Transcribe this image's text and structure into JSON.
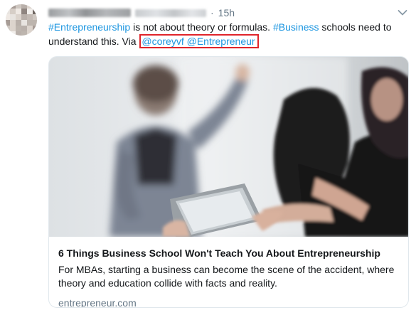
{
  "tweet": {
    "timestamp": "15h",
    "separator": "·",
    "text": {
      "hashtag_1": "#Entrepreneurship",
      "segment_1": " is not about theory or formulas. ",
      "hashtag_2": "#Business",
      "segment_2": " schools need to understand this. Via ",
      "mention_1": "@coreyvf",
      "mention_2": "@Entrepreneur"
    },
    "more_icon": "chevron-down-icon"
  },
  "card": {
    "title": "6 Things Business School Won't Teach You About Entrepreneurship",
    "description": "For MBAs, starting a business can become the scene of the accident, where theory and education collide with facts and reality.",
    "domain": "entrepreneur.com"
  },
  "colors": {
    "link": "#1b95e0",
    "highlight_box": "#e0242a",
    "muted": "#657786",
    "text": "#14171a",
    "card_border": "#e1e8ed"
  }
}
